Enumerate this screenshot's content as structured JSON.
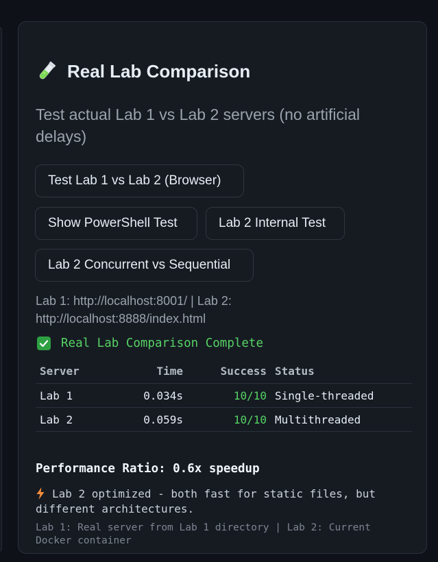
{
  "card": {
    "title": "Real Lab Comparison",
    "title_icon": "test-tube-icon",
    "subtitle": "Test actual Lab 1 vs Lab 2 servers (no artificial delays)"
  },
  "buttons": {
    "browser_test": "Test Lab 1 vs Lab 2 (Browser)",
    "powershell_test": "Show PowerShell Test",
    "internal_test": "Lab 2 Internal Test",
    "concurrent_test": "Lab 2 Concurrent vs Sequential"
  },
  "urls": {
    "text": "Lab 1: http://localhost:8001/ | Lab 2: http://localhost:8888/index.html"
  },
  "result": {
    "status_icon": "check-icon",
    "status_text": "Real Lab Comparison Complete",
    "table": {
      "headers": [
        "Server",
        "Time",
        "Success",
        "Status"
      ],
      "rows": [
        [
          "Lab 1",
          "0.034s",
          "10/10",
          "Single-threaded"
        ],
        [
          "Lab 2",
          "0.059s",
          "10/10",
          "Multithreaded"
        ]
      ]
    },
    "ratio": "Performance Ratio: 0.6x speedup",
    "note_icon": "lightning-icon",
    "note": "Lab 2 optimized - both fast for static files, but different architectures.",
    "footnote": "Lab 1: Real server from Lab 1 directory | Lab 2: Current Docker container"
  },
  "colors": {
    "background": "#0e1117",
    "card": "#161b22",
    "success": "#56d364"
  }
}
